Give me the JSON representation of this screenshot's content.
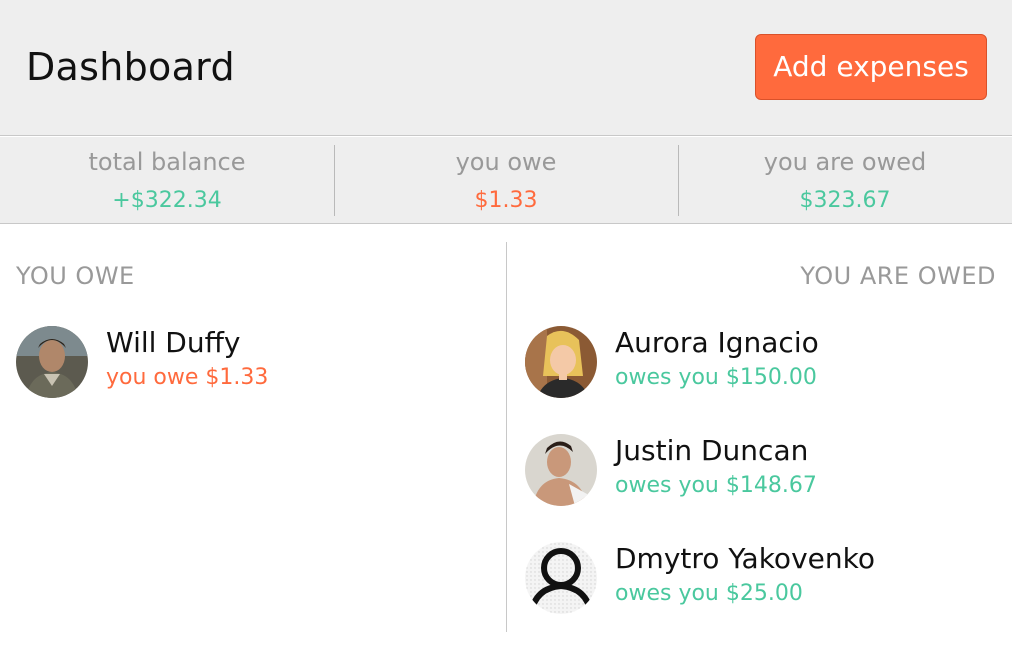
{
  "header": {
    "title": "Dashboard",
    "add_button_label": "Add expenses"
  },
  "summary": {
    "total_balance": {
      "label": "total balance",
      "value": "+$322.34"
    },
    "you_owe": {
      "label": "you owe",
      "value": "$1.33"
    },
    "you_are_owed": {
      "label": "you are owed",
      "value": "$323.67"
    }
  },
  "you_owe_section": {
    "heading": "YOU OWE",
    "people": [
      {
        "name": "Will Duffy",
        "line": "you owe $1.33"
      }
    ]
  },
  "you_are_owed_section": {
    "heading": "YOU ARE OWED",
    "people": [
      {
        "name": "Aurora Ignacio",
        "line": "owes you $150.00"
      },
      {
        "name": "Justin Duncan",
        "line": "owes you $148.67"
      },
      {
        "name": "Dmytro Yakovenko",
        "line": "owes you $25.00"
      }
    ]
  },
  "colors": {
    "accent": "#ff6a3d",
    "positive": "#4ac89e",
    "muted": "#999999",
    "panel": "#eeeeee"
  }
}
